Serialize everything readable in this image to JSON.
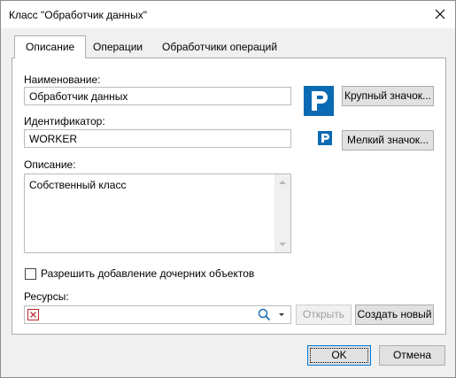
{
  "window": {
    "title": "Класс \"Обработчик данных\""
  },
  "tabs": [
    {
      "label": "Описание",
      "active": true
    },
    {
      "label": "Операции",
      "active": false
    },
    {
      "label": "Обработчики операций",
      "active": false
    }
  ],
  "form": {
    "name_label": "Наименование:",
    "name_value": "Обработчик данных",
    "id_label": "Идентификатор:",
    "id_value": "WORKER",
    "description_label": "Описание:",
    "description_value": "Собственный класс",
    "allow_children_label": "Разрешить добавление дочерних объектов",
    "allow_children_checked": false,
    "resources_label": "Ресурсы:",
    "resources_value": ""
  },
  "buttons": {
    "large_icon": "Крупный значок...",
    "small_icon": "Мелкий значок...",
    "open": "Открыть",
    "create_new": "Создать новый",
    "ok": "OK",
    "cancel": "Отмена"
  },
  "colors": {
    "accent": "#0a6ab3",
    "focus": "#0078d7",
    "error": "#c0262c"
  },
  "icons": [
    "close-icon",
    "class-logo-large-icon",
    "class-logo-small-icon",
    "invalid-resource-icon",
    "search-icon",
    "dropdown-arrow-icon"
  ]
}
